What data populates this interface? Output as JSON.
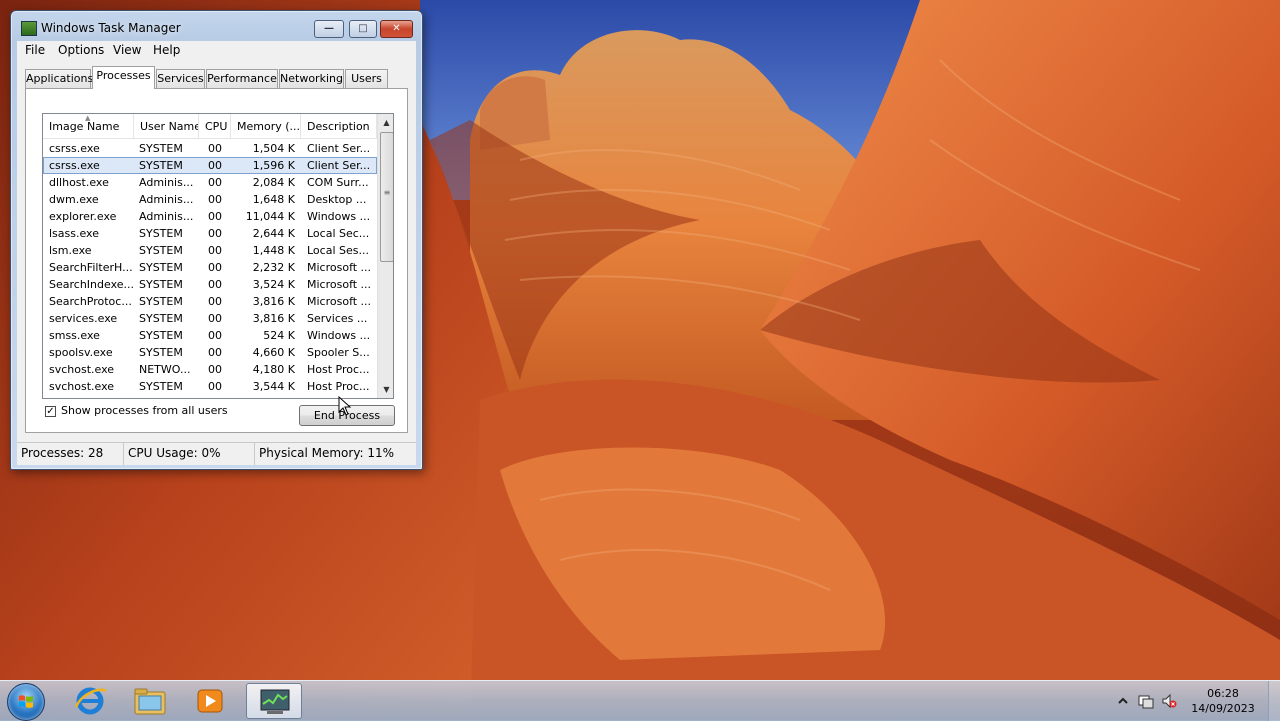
{
  "window": {
    "title": "Windows Task Manager",
    "min_glyph": "—",
    "max_glyph": "□",
    "close_glyph": "✕"
  },
  "menu": [
    "File",
    "Options",
    "View",
    "Help"
  ],
  "tabs": [
    "Applications",
    "Processes",
    "Services",
    "Performance",
    "Networking",
    "Users"
  ],
  "active_tab": "Processes",
  "columns": [
    "Image Name",
    "User Name",
    "CPU",
    "Memory (...",
    "Description"
  ],
  "processes": [
    {
      "name": "csrss.exe",
      "user": "SYSTEM",
      "cpu": "00",
      "memory": "1,504 K",
      "description": "Client Ser..."
    },
    {
      "name": "csrss.exe",
      "user": "SYSTEM",
      "cpu": "00",
      "memory": "1,596 K",
      "description": "Client Ser..."
    },
    {
      "name": "dllhost.exe",
      "user": "Adminis...",
      "cpu": "00",
      "memory": "2,084 K",
      "description": "COM Surr..."
    },
    {
      "name": "dwm.exe",
      "user": "Adminis...",
      "cpu": "00",
      "memory": "1,648 K",
      "description": "Desktop ..."
    },
    {
      "name": "explorer.exe",
      "user": "Adminis...",
      "cpu": "00",
      "memory": "11,044 K",
      "description": "Windows ..."
    },
    {
      "name": "lsass.exe",
      "user": "SYSTEM",
      "cpu": "00",
      "memory": "2,644 K",
      "description": "Local Sec..."
    },
    {
      "name": "lsm.exe",
      "user": "SYSTEM",
      "cpu": "00",
      "memory": "1,448 K",
      "description": "Local Ses..."
    },
    {
      "name": "SearchFilterH...",
      "user": "SYSTEM",
      "cpu": "00",
      "memory": "2,232 K",
      "description": "Microsoft ..."
    },
    {
      "name": "SearchIndexe...",
      "user": "SYSTEM",
      "cpu": "00",
      "memory": "3,524 K",
      "description": "Microsoft ..."
    },
    {
      "name": "SearchProtoc...",
      "user": "SYSTEM",
      "cpu": "00",
      "memory": "3,816 K",
      "description": "Microsoft ..."
    },
    {
      "name": "services.exe",
      "user": "SYSTEM",
      "cpu": "00",
      "memory": "3,816 K",
      "description": "Services ..."
    },
    {
      "name": "smss.exe",
      "user": "SYSTEM",
      "cpu": "00",
      "memory": "524 K",
      "description": "Windows ..."
    },
    {
      "name": "spoolsv.exe",
      "user": "SYSTEM",
      "cpu": "00",
      "memory": "4,660 K",
      "description": "Spooler S..."
    },
    {
      "name": "svchost.exe",
      "user": "NETWO...",
      "cpu": "00",
      "memory": "4,180 K",
      "description": "Host Proc..."
    },
    {
      "name": "svchost.exe",
      "user": "SYSTEM",
      "cpu": "00",
      "memory": "3,544 K",
      "description": "Host Proc..."
    }
  ],
  "selected_row_index": 1,
  "show_all_users": {
    "label": "Show processes from all users",
    "checked": true,
    "glyph": "✓"
  },
  "end_process_label": "End Process",
  "status": {
    "processes": "Processes: 28",
    "cpu": "CPU Usage: 0%",
    "memory": "Physical Memory: 11%"
  },
  "taskbar": {
    "pinned": [
      "start-button",
      "internet-explorer-icon",
      "windows-explorer-icon",
      "windows-media-player-icon",
      "task-manager-icon"
    ],
    "tray": [
      "show-hidden-icons",
      "action-center-icon",
      "volume-muted-icon"
    ],
    "clock_time": "06:28",
    "clock_date": "14/09/2023"
  }
}
